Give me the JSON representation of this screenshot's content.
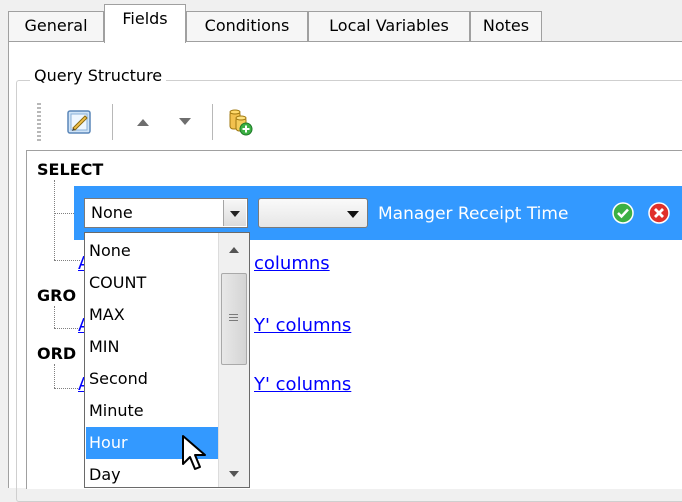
{
  "tabs": [
    {
      "label": "General",
      "active": false
    },
    {
      "label": "Fields",
      "active": true
    },
    {
      "label": "Conditions",
      "active": false
    },
    {
      "label": "Local Variables",
      "active": false
    },
    {
      "label": "Notes",
      "active": false
    }
  ],
  "group": {
    "title": "Query Structure"
  },
  "toolbar": {
    "icons": [
      "edit-icon",
      "move-up-icon",
      "move-down-icon",
      "add-database-icon"
    ]
  },
  "tree": {
    "select_label": "SELECT",
    "group_label": "GRO",
    "order_label": "ORD",
    "links": {
      "select_link_prefix": "A",
      "select_link_suffix": "columns",
      "group_link_prefix": "A",
      "group_link_suffix": "Y' columns",
      "order_link_prefix": "A",
      "order_link_suffix": "Y' columns"
    },
    "selected_row": {
      "aggregate_value": "None",
      "second_combo_value": "",
      "field_name": "Manager Receipt Time",
      "confirm_icon": "check-icon",
      "cancel_icon": "close-icon"
    }
  },
  "dropdown": {
    "options": [
      "None",
      "COUNT",
      "MAX",
      "MIN",
      "Second",
      "Minute",
      "Hour",
      "Day"
    ],
    "highlighted": "Hour"
  },
  "colors": {
    "selection": "#3399ff",
    "link": "#0000ff",
    "check": "#3cb044",
    "cancel": "#e0302a"
  }
}
